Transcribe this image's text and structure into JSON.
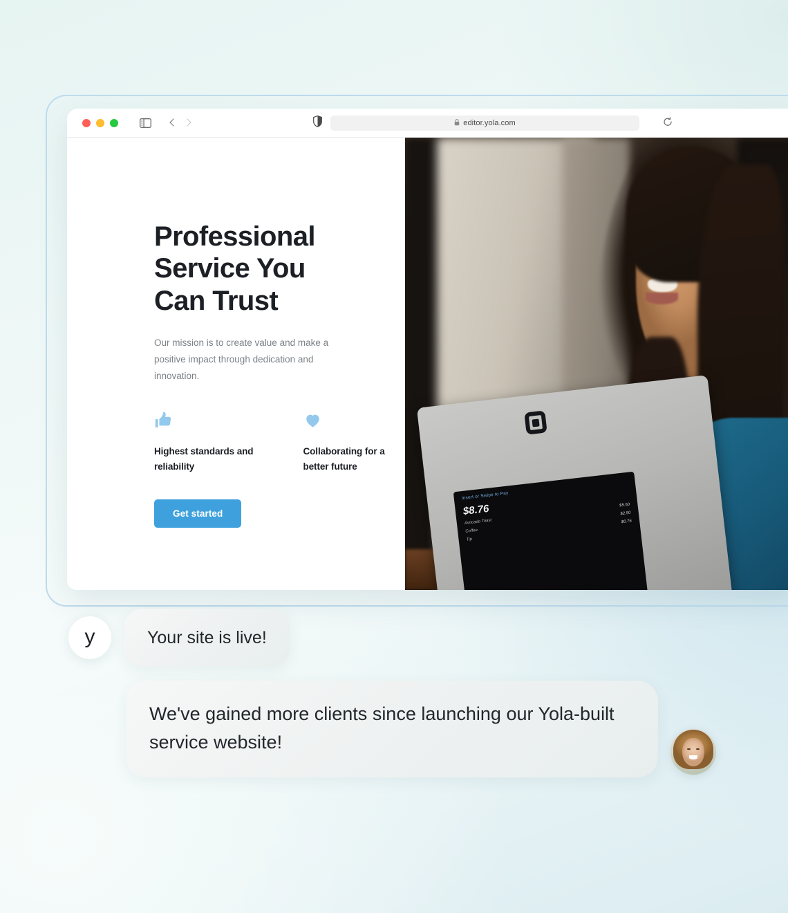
{
  "browser": {
    "url": "editor.yola.com",
    "lock_icon": "lock-icon",
    "traffic_lights": [
      "close-red",
      "minimize-yellow",
      "maximize-green"
    ],
    "sidebar_icon": "sidebar-toggle-icon",
    "back_icon": "chevron-left-icon",
    "forward_icon": "chevron-right-icon",
    "shield_icon": "privacy-shield-icon",
    "reload_icon": "reload-icon"
  },
  "site": {
    "hero": {
      "title": "Professional Service You Can Trust",
      "subtitle": "Our mission is to create value and make a positive impact through dedication and innovation.",
      "cta_label": "Get started",
      "cta_color": "#3ea1dd",
      "features": [
        {
          "icon": "thumbs-up-icon",
          "label": "Highest standards and reliability",
          "icon_color": "#93c9ec"
        },
        {
          "icon": "heart-icon",
          "label": "Collaborating for a better future",
          "icon_color": "#93c9ec"
        }
      ]
    },
    "photo": {
      "alt": "Smiling woman holding a tablet point-of-sale terminal",
      "pos_terminal": {
        "prompt": "Insert or Swipe to Pay",
        "total": "$8.76",
        "line_items": [
          {
            "name": "Avocado Toast",
            "price": "$5.50"
          },
          {
            "name": "Coffee",
            "price": "$2.50"
          },
          {
            "name": "Tip",
            "price": "$0.76"
          }
        ]
      },
      "brand_mark": "square-logo-icon"
    }
  },
  "chat": {
    "messages": [
      {
        "author": "yola",
        "avatar": "yola-logo-avatar",
        "avatar_glyph": "y",
        "text": "Your site is live!"
      },
      {
        "author": "user",
        "avatar": "user-photo-avatar",
        "text": "We've gained more clients since launching our Yola-built service website!"
      }
    ]
  },
  "theme": {
    "background_top_right": "#e2f2f0",
    "background_bottom_right": "#d3e8ef",
    "background_left": "#f7fcfb",
    "frame_border": "#bedcee",
    "bubble_bg": "#eef1f1",
    "text_dark": "#1c1f24",
    "text_muted": "#7b8287"
  }
}
